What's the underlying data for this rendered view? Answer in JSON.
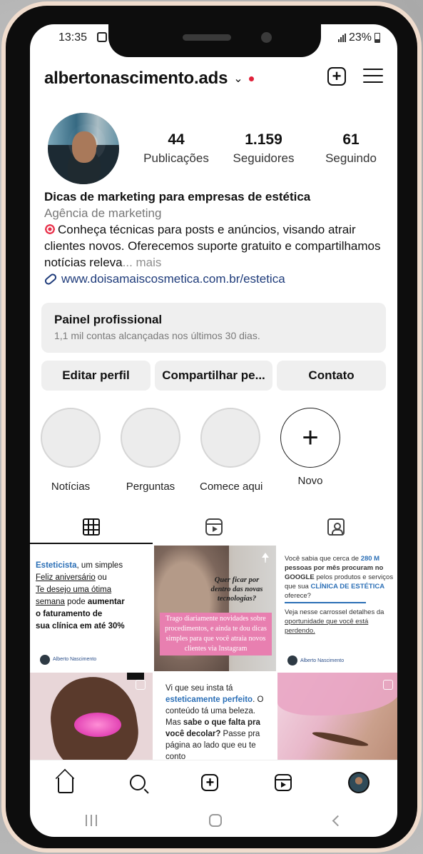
{
  "status_bar": {
    "time": "13:35",
    "battery": "23%"
  },
  "header": {
    "username": "albertonascimento.ads",
    "chevron": "⌄"
  },
  "profile": {
    "stats": [
      {
        "value": "44",
        "label": "Publicações"
      },
      {
        "value": "1.159",
        "label": "Seguidores"
      },
      {
        "value": "61",
        "label": "Seguindo"
      }
    ],
    "bio": {
      "name": "Dicas de marketing para empresas de estética",
      "category": "Agência de marketing",
      "text": "Conheça técnicas para posts e anúncios, visando atrair clientes novos. Oferecemos suporte gratuito e compartilhamos notícias releva",
      "more": "... mais",
      "link": "www.doisamaiscosmetica.com.br/estetica"
    }
  },
  "panel": {
    "title": "Painel profissional",
    "subtitle": "1,1 mil contas alcançadas nos últimos 30 dias."
  },
  "buttons": {
    "edit": "Editar perfil",
    "share": "Compartilhar pe...",
    "contact": "Contato"
  },
  "highlights": [
    {
      "label": "Notícias"
    },
    {
      "label": "Perguntas"
    },
    {
      "label": "Comece aqui"
    },
    {
      "label": "Novo",
      "plus": "+"
    }
  ],
  "posts": {
    "p1": {
      "l1a": "Esteticista",
      "l1b": ", um simples",
      "l2": "Feliz aniversário",
      "l2b": " ou",
      "l3": "Te desejo uma ótima",
      "l4": "semana",
      "l4b": " pode ",
      "l4c": "aumentar",
      "l5": "o faturamento de",
      "l6": "sua clínica em até 30%",
      "sig": "Alberto Nascimento"
    },
    "p2": {
      "quote": "Quer ficar por dentro das novas tecnologias?",
      "pink": "Trago diariamente novidades sobre procedimentos, e ainda te dou dicas simples para que você atraia novos clientes via Instagram"
    },
    "p3": {
      "a": "Você sabia que cerca de ",
      "b": "280 M",
      "c": " pessoas por mês procuram no GOOGLE",
      "d": " pelos produtos e serviços que sua ",
      "e": "CLÍNICA DE ESTÉTICA",
      "f": " oferece?",
      "g": "Veja nesse carrossel detalhes da ",
      "h": "oportunidade que você está perdendo.",
      "sig": "Alberto Nascimento"
    },
    "p5": {
      "a": "Vi que seu insta tá ",
      "b": "esteticamente perfeito",
      "c": ". O conteúdo tá uma beleza. Mas ",
      "d": "sabe o que falta pra você decolar?",
      "e": " Passe pra página ao lado que eu te conto"
    }
  }
}
